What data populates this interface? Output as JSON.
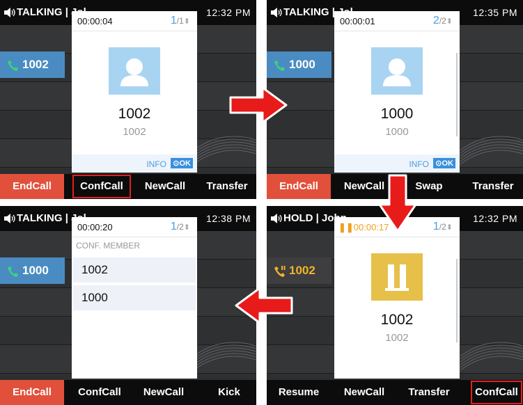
{
  "screens": [
    {
      "status": "TALKING | Jol",
      "time": "12:32 PM",
      "line": "1002",
      "timer": "00:00:04",
      "page_current": "1",
      "page_total": "/1",
      "name": "1002",
      "number": "1002",
      "info": "INFO",
      "ok": "OK",
      "softkeys": [
        "EndCall",
        "ConfCall",
        "NewCall",
        "Transfer"
      ]
    },
    {
      "status": "TALKING | Jol",
      "time": "12:35 PM",
      "line": "1000",
      "timer": "00:00:01",
      "page_current": "2",
      "page_total": "/2",
      "name": "1000",
      "number": "1000",
      "info": "INFO",
      "ok": "OK",
      "softkeys": [
        "EndCall",
        "NewCall",
        "Swap",
        "Transfer"
      ]
    },
    {
      "status": "TALKING | Jol",
      "time": "12:38 PM",
      "line": "1000",
      "timer": "00:00:20",
      "page_current": "1",
      "page_total": "/2",
      "conf_label": "CONF. MEMBER",
      "members": [
        "1002",
        "1000"
      ],
      "softkeys": [
        "EndCall",
        "ConfCall",
        "NewCall",
        "Kick"
      ]
    },
    {
      "status": "HOLD | John",
      "time": "12:32 PM",
      "line": "1002",
      "timer": "00:00:17",
      "page_current": "1",
      "page_total": "/2",
      "name": "1002",
      "number": "1002",
      "softkeys": [
        "Resume",
        "NewCall",
        "Transfer",
        "ConfCall"
      ]
    }
  ],
  "colors": {
    "accent_blue": "#4a8cc2",
    "endcall_red": "#e1503b",
    "hold_orange": "#f0b429",
    "arrow_red": "#e81b1b"
  },
  "icons": {
    "speaker": "speaker-icon",
    "phone": "phone-icon",
    "contact": "contact-avatar-icon",
    "pause": "pause-icon",
    "flow_arrow": "arrow-icon"
  }
}
